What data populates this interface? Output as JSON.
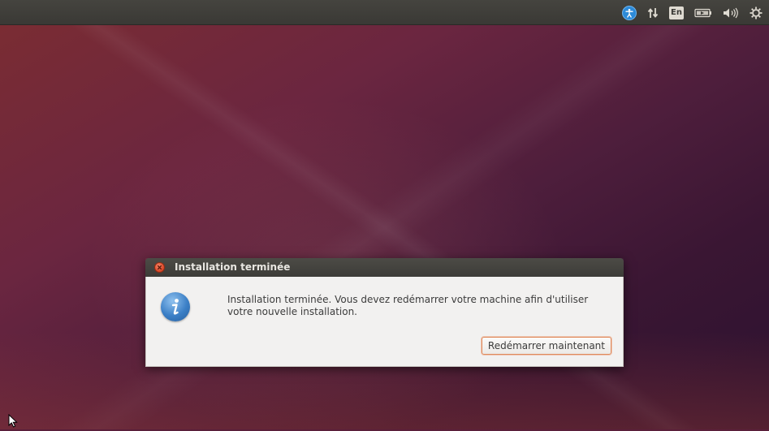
{
  "topbar": {
    "indicators": [
      {
        "name": "accessibility-icon"
      },
      {
        "name": "network-icon"
      },
      {
        "name": "keyboard-layout",
        "label": "En"
      },
      {
        "name": "battery-icon"
      },
      {
        "name": "volume-icon"
      },
      {
        "name": "settings-gear-icon"
      }
    ]
  },
  "dialog": {
    "title": "Installation terminée",
    "message": "Installation terminée. Vous devez redémarrer votre machine afin d'utiliser votre nouvelle installation.",
    "button_label": "Redémarrer maintenant",
    "icon": "info-icon"
  },
  "colors": {
    "accent": "#dd4b2b",
    "panel": "#3c3b37",
    "info_icon": "#3b7fc6",
    "button_focus_border": "#e08a5c"
  }
}
